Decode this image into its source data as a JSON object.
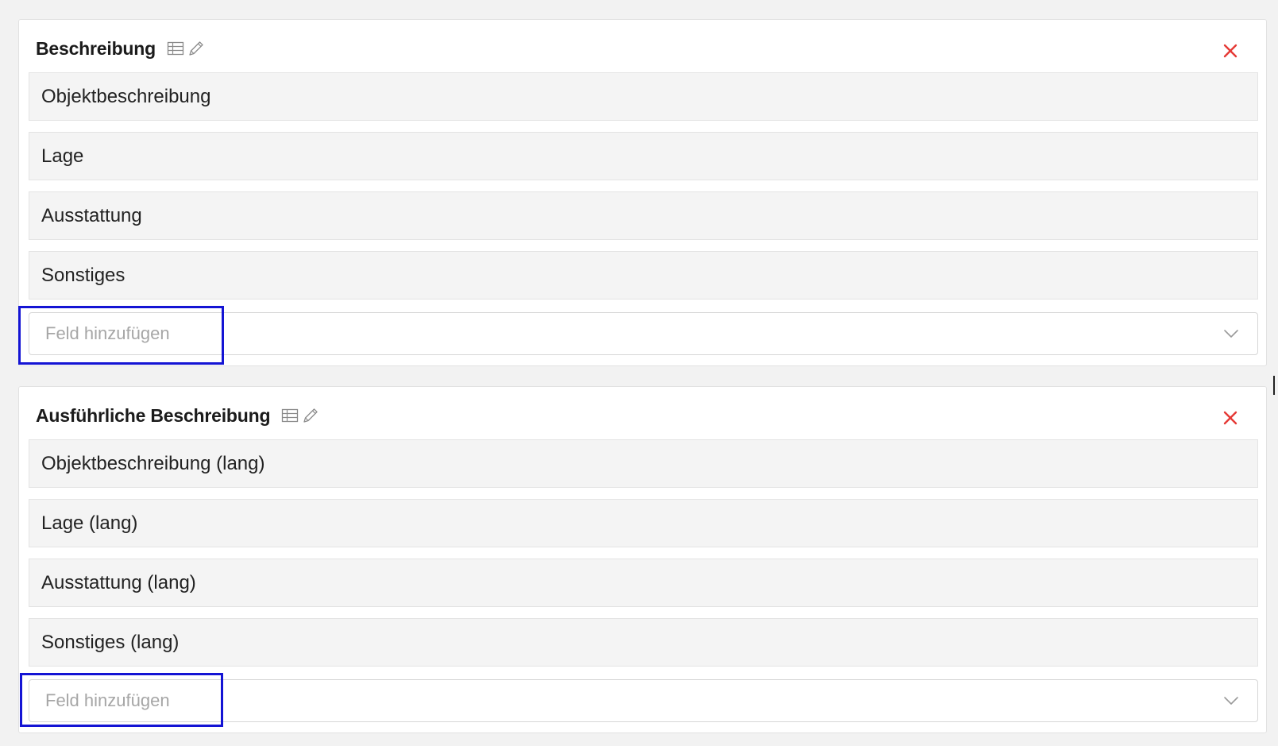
{
  "sections": [
    {
      "title": "Beschreibung",
      "table_icon": "table-icon",
      "edit_icon": "pencil-icon",
      "remove_icon": "close-icon",
      "fields": [
        "Objektbeschreibung",
        "Lage",
        "Ausstattung",
        "Sonstiges"
      ],
      "add_field_placeholder": "Feld hinzufügen"
    },
    {
      "title": "Ausführliche Beschreibung",
      "table_icon": "table-icon",
      "edit_icon": "pencil-icon",
      "remove_icon": "close-icon",
      "fields": [
        "Objektbeschreibung (lang)",
        "Lage (lang)",
        "Ausstattung (lang)",
        "Sonstiges (lang)"
      ],
      "add_field_placeholder": "Feld hinzufügen"
    }
  ],
  "colors": {
    "page_background": "#f2f2f2",
    "card_background": "#ffffff",
    "field_background": "#f4f4f4",
    "remove_icon": "#e53935",
    "highlight": "#1414d4",
    "placeholder_text": "#a6a6a6"
  },
  "icons": {
    "dropdown": "chevron-down-icon"
  }
}
